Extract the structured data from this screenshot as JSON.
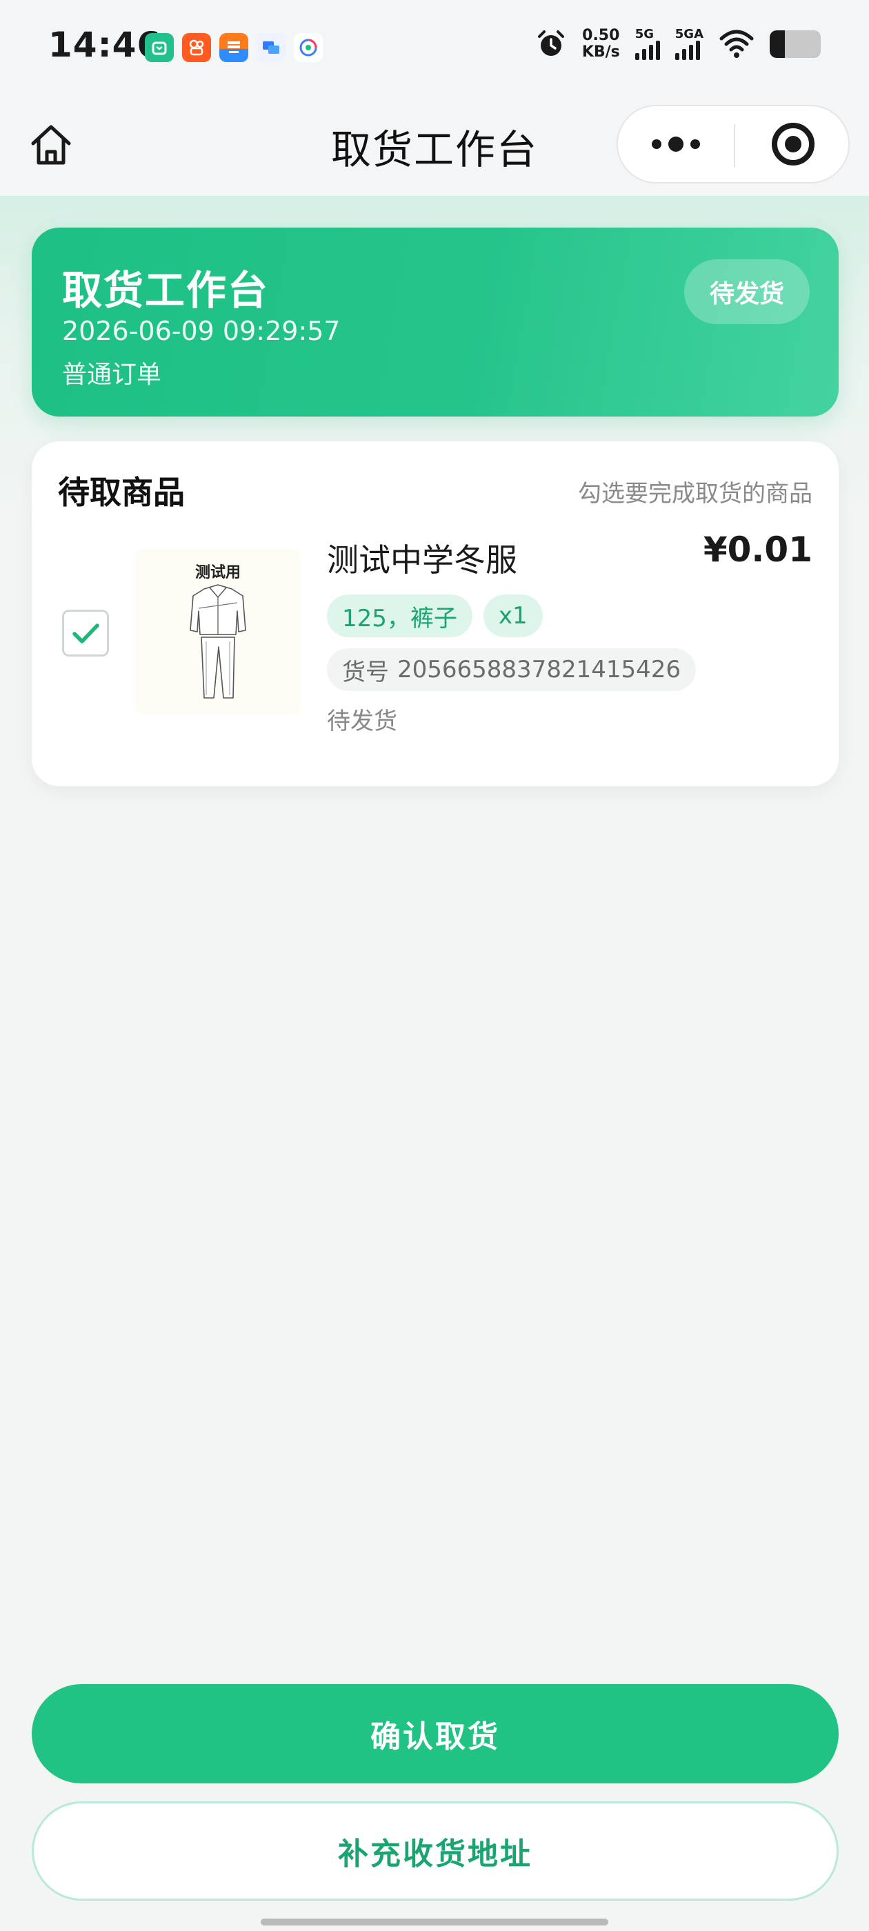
{
  "status_bar": {
    "time": "14:46",
    "speed_value": "0.50",
    "speed_unit": "KB/s",
    "signal1_label": "5G",
    "signal2_label": "5GA",
    "battery_level": 0.3,
    "app_icons": [
      "mi-home-icon",
      "kuaishou-icon",
      "taobao-flash-icon",
      "message-icon",
      "browser-icon"
    ]
  },
  "nav": {
    "title": "取货工作台",
    "home_icon": "home-icon",
    "more_icon": "more-icon",
    "close_icon": "target-icon"
  },
  "header": {
    "title": "取货工作台",
    "datetime": "2026-06-09 09:29:57",
    "order_type": "普通订单",
    "status": "待发货",
    "color_start": "#1ec083",
    "color_end": "#44d3a0"
  },
  "items": {
    "title": "待取商品",
    "hint": "勾选要完成取货的商品",
    "list": [
      {
        "checked": true,
        "image_caption": "测试用",
        "name": "测试中学冬服",
        "price": "¥0.01",
        "tags": [
          "125，裤子",
          "x1"
        ],
        "sku_label": "货号",
        "sku_value": "2056658837821415426",
        "status": "待发货"
      }
    ]
  },
  "actions": {
    "confirm": "确认取货",
    "add_address": "补充收货地址",
    "accent_color": "#20c384"
  }
}
